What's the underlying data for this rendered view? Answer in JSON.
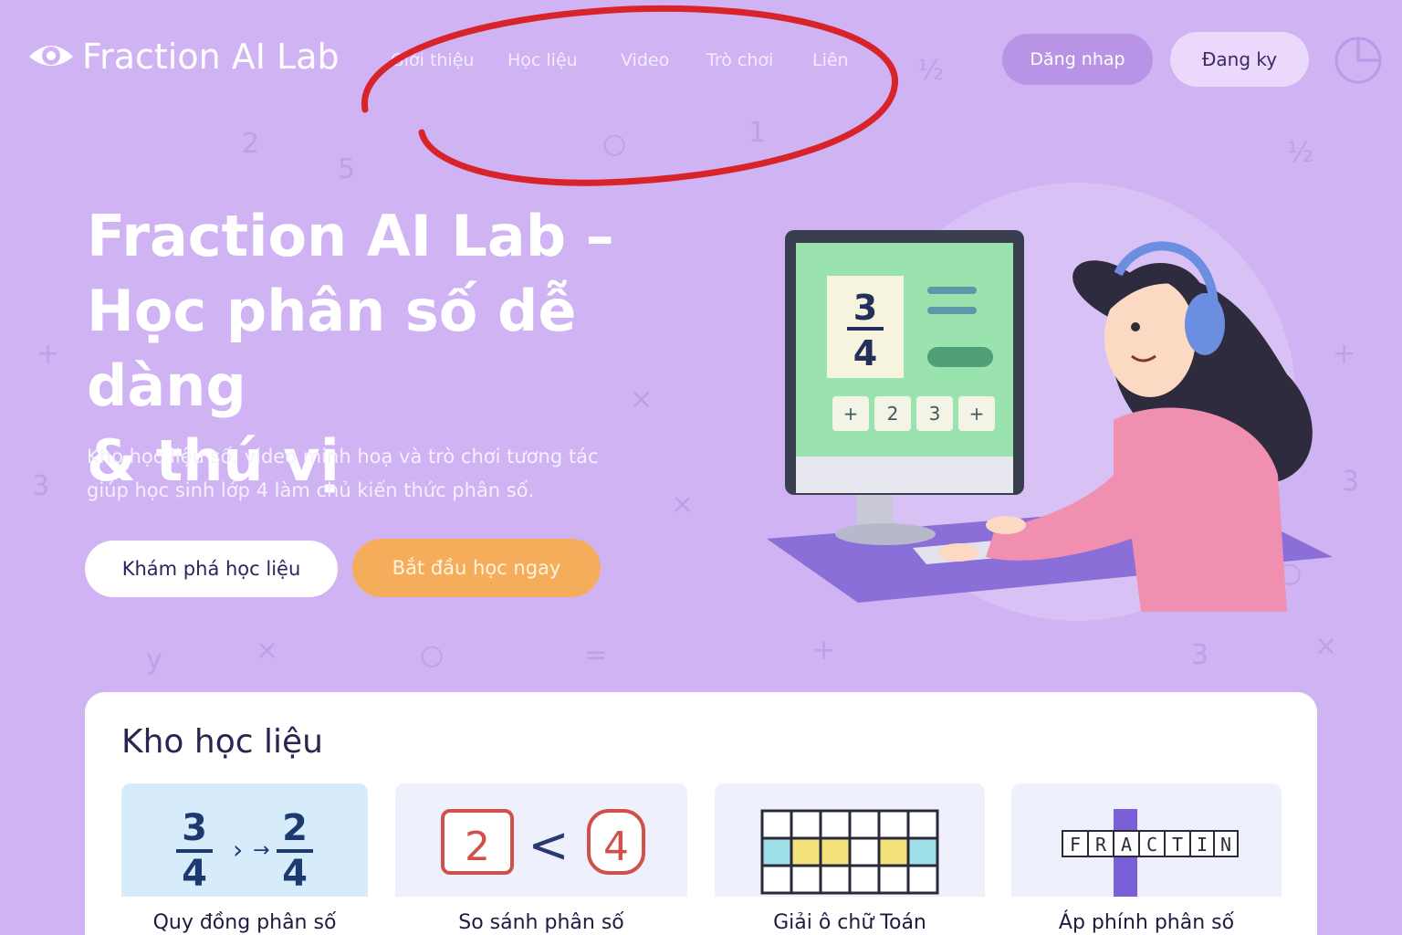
{
  "header": {
    "logo_text": "Fraction AI Lab",
    "nav": [
      "Giới thiệu",
      "Học liệu",
      "Video",
      "Trò chơi",
      "Liên"
    ],
    "login_label": "Dăng nhap",
    "register_label": "Đang ky"
  },
  "hero": {
    "title_line1": "Fraction AI Lab –",
    "title_line2": "Học phân số dễ dàng",
    "title_line3": "& thú vị",
    "subtitle_line1": "Kho học liệu số, video minh hoạ và trò chơi tương tác",
    "subtitle_line2": "giúp học sinh lớp 4 làm chủ kiến thức phân số.",
    "explore_label": "Khám phá học liệu",
    "start_label": "Bắt đầu học ngay"
  },
  "screen": {
    "numerator": "3",
    "denominator": "4",
    "keys": [
      "+",
      "2",
      "3",
      "+"
    ]
  },
  "library": {
    "title": "Kho học liệu",
    "cards": [
      {
        "label": "Quy đồng phân số",
        "n1": "3",
        "d1": "4",
        "n2": "2",
        "d2": "4"
      },
      {
        "label": "So sánh phân số",
        "a": "2",
        "op": "<",
        "b": "4"
      },
      {
        "label": "Giải ô chữ Toán"
      },
      {
        "label": "Áp phính phân số",
        "letters": [
          "F",
          "R",
          "A",
          "C",
          "T",
          "I",
          "N"
        ]
      }
    ]
  },
  "colors": {
    "background": "#cfb3f2",
    "accent_orange": "#f5ad5c",
    "annotation_red": "#d8232a",
    "card_blue": "#d7ecfa",
    "card_lavender": "#eef0fb"
  }
}
